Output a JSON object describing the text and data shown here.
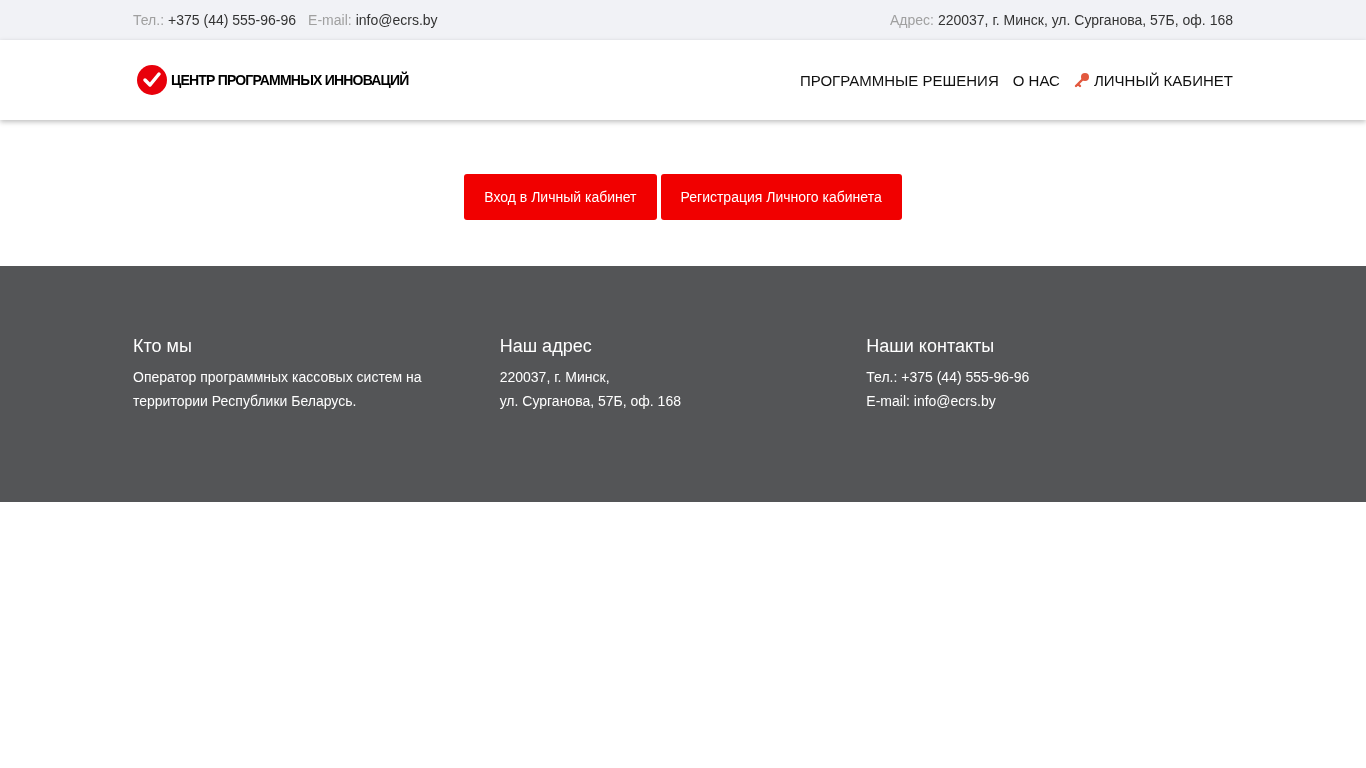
{
  "topbar": {
    "phone_label": "Тел.:",
    "phone": "+375 (44) 555-96-96",
    "email_label": "E-mail:",
    "email": "info@ecrs.by",
    "address_label": "Адрес:",
    "address": "220037, г. Минск, ул. Сурганова, 57Б, оф. 168"
  },
  "header": {
    "logo_text": "ЦЕНТР ПРОГРАММНЫХ ИННОВАЦИЙ",
    "nav": [
      {
        "label": "ПРОГРАММНЫЕ РЕШЕНИЯ",
        "kind": "link"
      },
      {
        "label": "О НАС",
        "kind": "link"
      },
      {
        "label": "ЛИЧНЫЙ КАБИНЕТ",
        "kind": "account"
      }
    ]
  },
  "buttons": [
    "Вход в Личный кабинет",
    "Регистрация Личного кабинета"
  ],
  "footer": {
    "columns": [
      {
        "title": "Кто мы",
        "lines": [
          "Оператор программных кассовых систем на территории Республики Беларусь."
        ]
      },
      {
        "title": "Наш адрес",
        "lines": [
          "220037, г. Минск,",
          "ул. Сурганова, 57Б, оф. 168"
        ]
      },
      {
        "title": "Наши контакты",
        "lines": [
          "Тел.: +375 (44) 555-96-96",
          "E-mail: info@ecrs.by"
        ]
      }
    ]
  }
}
